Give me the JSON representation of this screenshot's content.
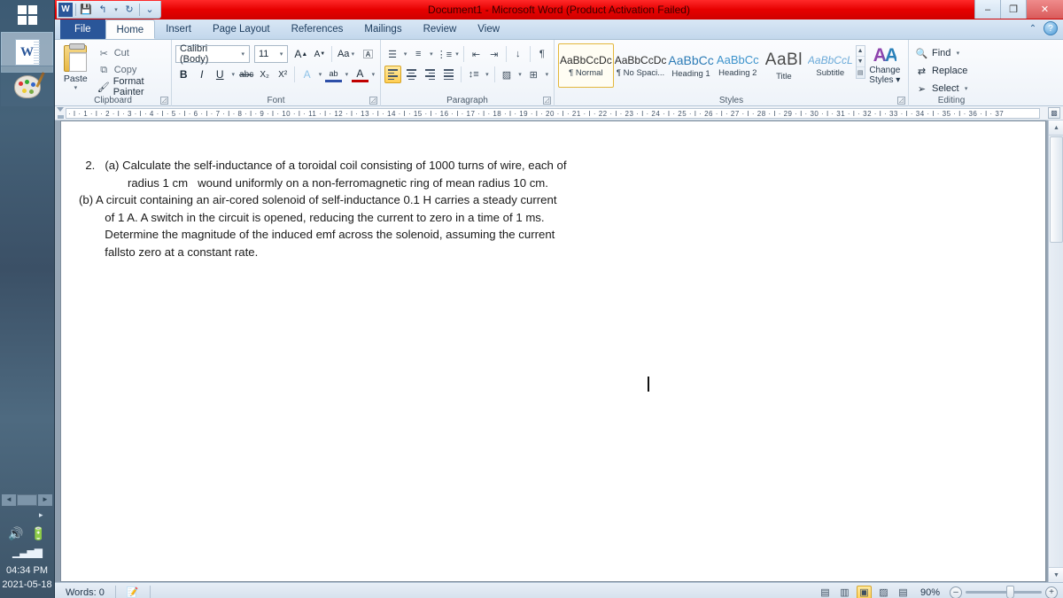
{
  "desktop": {
    "start_icon": "windows-logo-icon",
    "taskbar_apps": [
      {
        "name": "word-taskbar-icon",
        "label": "W"
      },
      {
        "name": "paint-taskbar-icon",
        "label": ""
      }
    ],
    "tray": {
      "volume_icon": "speaker-icon",
      "battery_icon": "battery-icon",
      "signal_icon": "signal-bars-icon",
      "time": "04:34 PM",
      "date": "2021-05-18"
    }
  },
  "window": {
    "title": "Document1  -  Microsoft Word (Product Activation Failed)",
    "controls": {
      "minimize": "–",
      "restore": "❐",
      "close": "✕"
    },
    "quick_access": [
      "word-logo-icon",
      "save-icon",
      "undo-icon",
      "redo-icon",
      "customize-qat-icon"
    ],
    "help": {
      "collapse_ribbon": "⌃",
      "help": "?"
    }
  },
  "tabs": [
    {
      "label": "File",
      "active": false,
      "kind": "file"
    },
    {
      "label": "Home",
      "active": true,
      "kind": "normal"
    },
    {
      "label": "Insert",
      "active": false,
      "kind": "normal"
    },
    {
      "label": "Page Layout",
      "active": false,
      "kind": "normal"
    },
    {
      "label": "References",
      "active": false,
      "kind": "normal"
    },
    {
      "label": "Mailings",
      "active": false,
      "kind": "normal"
    },
    {
      "label": "Review",
      "active": false,
      "kind": "normal"
    },
    {
      "label": "View",
      "active": false,
      "kind": "normal"
    }
  ],
  "ribbon": {
    "clipboard": {
      "title": "Clipboard",
      "paste": "Paste",
      "cut": "Cut",
      "copy": "Copy",
      "format_painter": "Format Painter"
    },
    "font": {
      "title": "Font",
      "font_name": "Calibri (Body)",
      "font_size": "11",
      "grow_font": "A",
      "shrink_font": "A",
      "change_case": "Aa",
      "clear_formatting": "clear-formatting-icon",
      "bold": "B",
      "italic": "I",
      "underline": "U",
      "strikethrough": "abc",
      "subscript": "X₂",
      "superscript": "X²",
      "text_effects": "A",
      "highlight": "ab",
      "font_color": "A"
    },
    "paragraph": {
      "title": "Paragraph",
      "bullets": "bullets-icon",
      "numbering": "numbering-icon",
      "multilevel": "multilevel-list-icon",
      "decrease_indent": "decrease-indent-icon",
      "increase_indent": "increase-indent-icon",
      "sort": "sort-icon",
      "show_marks": "¶",
      "align_left": "align-left-icon",
      "align_center": "align-center-icon",
      "align_right": "align-right-icon",
      "justify": "justify-icon",
      "line_spacing": "line-spacing-icon",
      "shading": "shading-icon",
      "borders": "borders-icon"
    },
    "styles": {
      "title": "Styles",
      "items": [
        {
          "preview": "AaBbCcDc",
          "name": "¶ Normal",
          "selected": true
        },
        {
          "preview": "AaBbCcDc",
          "name": "¶ No Spaci...",
          "selected": false
        },
        {
          "preview": "AaBbCc",
          "name": "Heading 1",
          "selected": false
        },
        {
          "preview": "AaBbCc",
          "name": "Heading 2",
          "selected": false
        },
        {
          "preview": "AaBl",
          "name": "Title",
          "selected": false
        },
        {
          "preview": "AaBbCcL",
          "name": "Subtitle",
          "selected": false
        }
      ],
      "change_styles_line1": "Change",
      "change_styles_line2": "Styles"
    },
    "editing": {
      "title": "Editing",
      "find": "Find",
      "replace": "Replace",
      "select": "Select"
    }
  },
  "ruler": {
    "ticks": "·  I  ·  1  ·  I  ·  2  ·  I  ·  3  ·  I  ·  4  ·  I  ·  5  ·  I  ·  6  ·  I  ·  7  ·  I  ·  8  ·  I  ·  9  ·  I  · 10 ·  I  · 11 ·  I  · 12 ·  I  · 13 ·  I  · 14 ·  I  · 15 ·  I  · 16 ·  I  · 17 ·  I  · 18 ·  I  · 19 ·  I  · 20 ·  I  · 21 ·  I  · 22 ·  I  · 23 ·  I  · 24 ·  I  · 25 ·  I  · 26 ·  I  · 27 ·  I  · 28 ·  I  · 29 ·  I  · 30 ·  I  · 31 ·  I  · 32 ·  I  · 33 ·  I  · 34 ·  I  · 35 ·  I  · 36 ·  I  · 37",
    "corner_icon": "select-browse-object-icon"
  },
  "document": {
    "lines": [
      "  2.   (a) Calculate the self-inductance of a toroidal coil consisting of 1000 turns of wire, each of",
      "               radius 1 cm   wound uniformly on a non-ferromagnetic ring of mean radius 10 cm.",
      "(b) A circuit containing an air-cored solenoid of self-inductance 0.1 H carries a steady current",
      "        of 1 A. A switch in the circuit is opened, reducing the current to zero in a time of 1 ms.",
      "        Determine the magnitude of the induced emf across the solenoid, assuming the current",
      "        fallsto zero at a constant rate."
    ]
  },
  "statusbar": {
    "words": "Words: 0",
    "proofing_icon": "spelling-check-icon",
    "views": [
      {
        "name": "print-layout-view",
        "glyph": "▤",
        "active": false
      },
      {
        "name": "full-screen-reading-view",
        "glyph": "▥",
        "active": false
      },
      {
        "name": "web-layout-view",
        "glyph": "▣",
        "active": true
      },
      {
        "name": "outline-view",
        "glyph": "▨",
        "active": false
      },
      {
        "name": "draft-view",
        "glyph": "▤",
        "active": false
      }
    ],
    "zoom": "90%",
    "zoom_out": "–",
    "zoom_in": "+"
  }
}
